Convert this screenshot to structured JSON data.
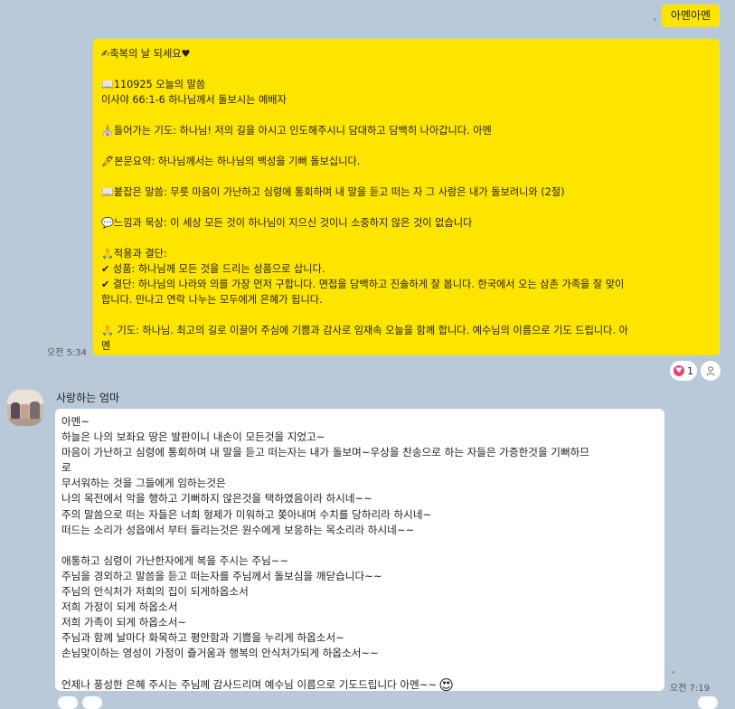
{
  "top_message": {
    "text": "아멘아멘"
  },
  "daily_message": {
    "lines": [
      "✍축복의 날 되세요♥",
      "",
      "📖110925 오늘의 말씀",
      "이사야 66:1-6 하나님께서 돌보시는 예배자",
      "",
      "⛪들어가는 기도: 하나님! 저의 길을 아시고 인도해주시니 담대하고 담백히 나아갑니다. 아멘",
      "",
      "🖊본문요약: 하나님께서는 하나님의 백성을 기뻐 돌보십니다.",
      "",
      "📖붙잡은 말씀: 무릇 마음이 가난하고 심령에 통회하며 내 말을 듣고 떠는 자 그 사람은 내가 돌보려니와 (2절)",
      "",
      "💬느낌과 묵상: 이 세상 모든 것이 하나님이 지으신 것이니 소중하지 않은 것이 없습니다",
      "",
      "🙏적용과 결단:",
      "✔ 성품: 하나님께 모든 것을 드리는 성품으로 삽니다.",
      "✔ 결단: 하나님의 나라와 의를 가장 먼저 구합니다. 면접을 담백하고 진솔하게 잘 봅니다. 한국에서 오는 삼촌 가족을 잘 맞이",
      "합니다. 만나고 연락 나누는 모두에게 은혜가 됩니다.",
      "",
      "🙏 기도: 하나님. 최고의 길로 이끌어 주심에 기쁨과 감사로 임재속 오늘을 함께 합니다. 예수님의 이름으로 기도 드립니다. 아",
      "멘"
    ],
    "time": "오전 5:34"
  },
  "reaction": {
    "count": "1"
  },
  "sender": {
    "name": "사랑하는 엄마"
  },
  "reply": {
    "lines": [
      "아멘~",
      "하늘은 나의 보좌요 땅은 발판이니 내손이 모든것을 지었고~",
      "마음이 가난하고 심령에 통회하며 내 말을 듣고 떠는자는 내가 돌보며~우상을 찬송으로 하는 자들은 가증한것을 기뻐하므",
      "로",
      "무서워하는 것을 그들에게 임하는것은",
      "나의 목전에서 악을 행하고 기뻐하지 않은것을 택하였음이라 하시네~~",
      "주의 말씀으로 떠는 자들은 너희 형제가 미워하고 쫒아내며 수치를 당하리라 하시네~",
      "떠드는 소리가 성읍에서 부터 들리는것은 원수에게 보응하는 목소리라 하시네~~",
      "",
      "애통하고 심령이 가난한자에게 복을 주시는 주님~~",
      "주님을 경외하고 말씀을 듣고 떠는자를 주님께서 돌보심을 깨닫습니다~~",
      "주님의 안식처가 저희의 집이 되게하옵소서",
      "저희 가정이 되게 하옵소서",
      "저희 가족이 되게 하옵소서~",
      "주님과 함께 날마다 화목하고 평안함과 기쁨을 누리게 하옵소서~",
      "손님맞이하는 영성이 가정이 즐거움과 행복의 안식처가되게 하옵소서~~",
      "",
      "언제나 풍성한 은혜 주시는 주님께 감사드리며 예수님 이름으로 기도드립니다 아멘~~"
    ],
    "emoji": "😍",
    "time": "오전 7:19"
  },
  "colors": {
    "background": "#b9c9da",
    "yellow_bubble": "#fee500",
    "white_bubble": "#ffffff",
    "heart": "#e8437b"
  }
}
